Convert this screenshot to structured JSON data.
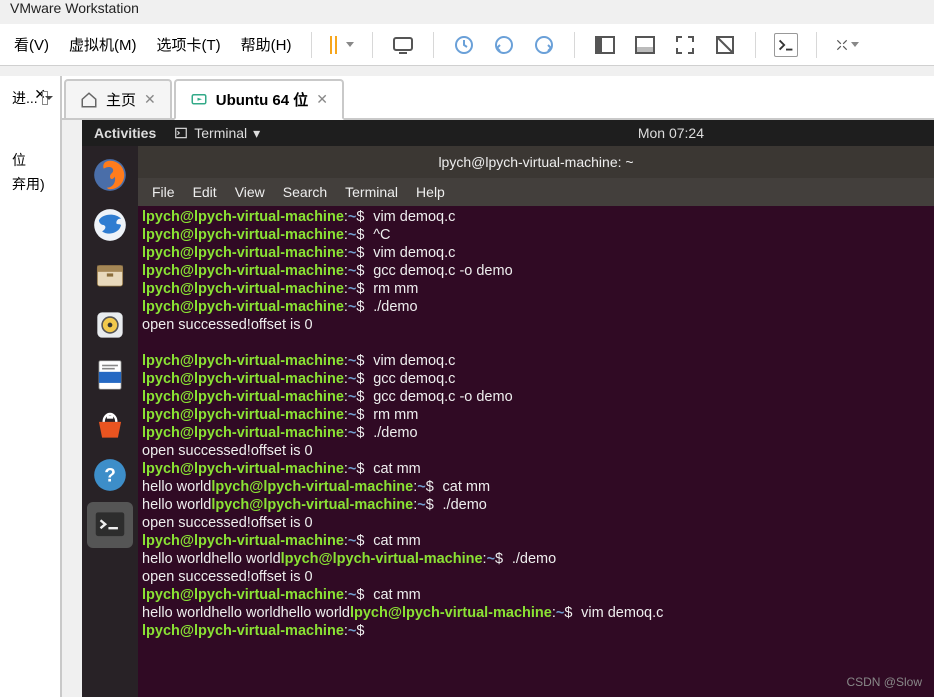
{
  "host": {
    "title": "VMware Workstation",
    "menu": [
      "看(V)",
      "虚拟机(M)",
      "选项卡(T)",
      "帮助(H)"
    ],
    "left_panel": {
      "search_label": "进...",
      "item1": "位",
      "item2": "弃用)"
    }
  },
  "tabs": {
    "home": {
      "label": "主页"
    },
    "vm": {
      "label": "Ubuntu 64 位"
    }
  },
  "ubuntu": {
    "activities": "Activities",
    "app_label": "Terminal",
    "clock": "Mon 07:24"
  },
  "terminal": {
    "title": "lpych@lpych-virtual-machine: ~",
    "menu": [
      "File",
      "Edit",
      "View",
      "Search",
      "Terminal",
      "Help"
    ],
    "user": "lpych@lpych-virtual-machine",
    "path": "~",
    "lines": [
      {
        "type": "prompt",
        "cmd": "vim demoq.c"
      },
      {
        "type": "prompt",
        "cmd": "^C"
      },
      {
        "type": "prompt",
        "cmd": "vim demoq.c"
      },
      {
        "type": "prompt",
        "cmd": "gcc demoq.c -o demo"
      },
      {
        "type": "prompt",
        "cmd": "rm mm"
      },
      {
        "type": "prompt",
        "cmd": "./demo"
      },
      {
        "type": "out",
        "text": "open successed!offset is 0"
      },
      {
        "type": "blank"
      },
      {
        "type": "prompt",
        "cmd": "vim demoq.c"
      },
      {
        "type": "prompt",
        "cmd": "gcc demoq.c"
      },
      {
        "type": "prompt",
        "cmd": "gcc demoq.c -o demo"
      },
      {
        "type": "prompt",
        "cmd": "rm mm"
      },
      {
        "type": "prompt",
        "cmd": "./demo"
      },
      {
        "type": "out",
        "text": "open successed!offset is 0"
      },
      {
        "type": "prompt",
        "cmd": "cat mm"
      },
      {
        "type": "mix",
        "pre": "hello world",
        "cmd": "cat mm"
      },
      {
        "type": "mix",
        "pre": "hello world",
        "cmd": "./demo"
      },
      {
        "type": "out",
        "text": "open successed!offset is 0"
      },
      {
        "type": "prompt",
        "cmd": "cat mm"
      },
      {
        "type": "mix",
        "pre": "hello worldhello world",
        "cmd": "./demo"
      },
      {
        "type": "out",
        "text": "open successed!offset is 0"
      },
      {
        "type": "prompt",
        "cmd": "cat mm"
      },
      {
        "type": "mix",
        "pre": "hello worldhello worldhello world",
        "cmd": "vim demoq.c"
      },
      {
        "type": "prompt",
        "cmd": ""
      }
    ]
  },
  "watermark": "CSDN @Slow"
}
